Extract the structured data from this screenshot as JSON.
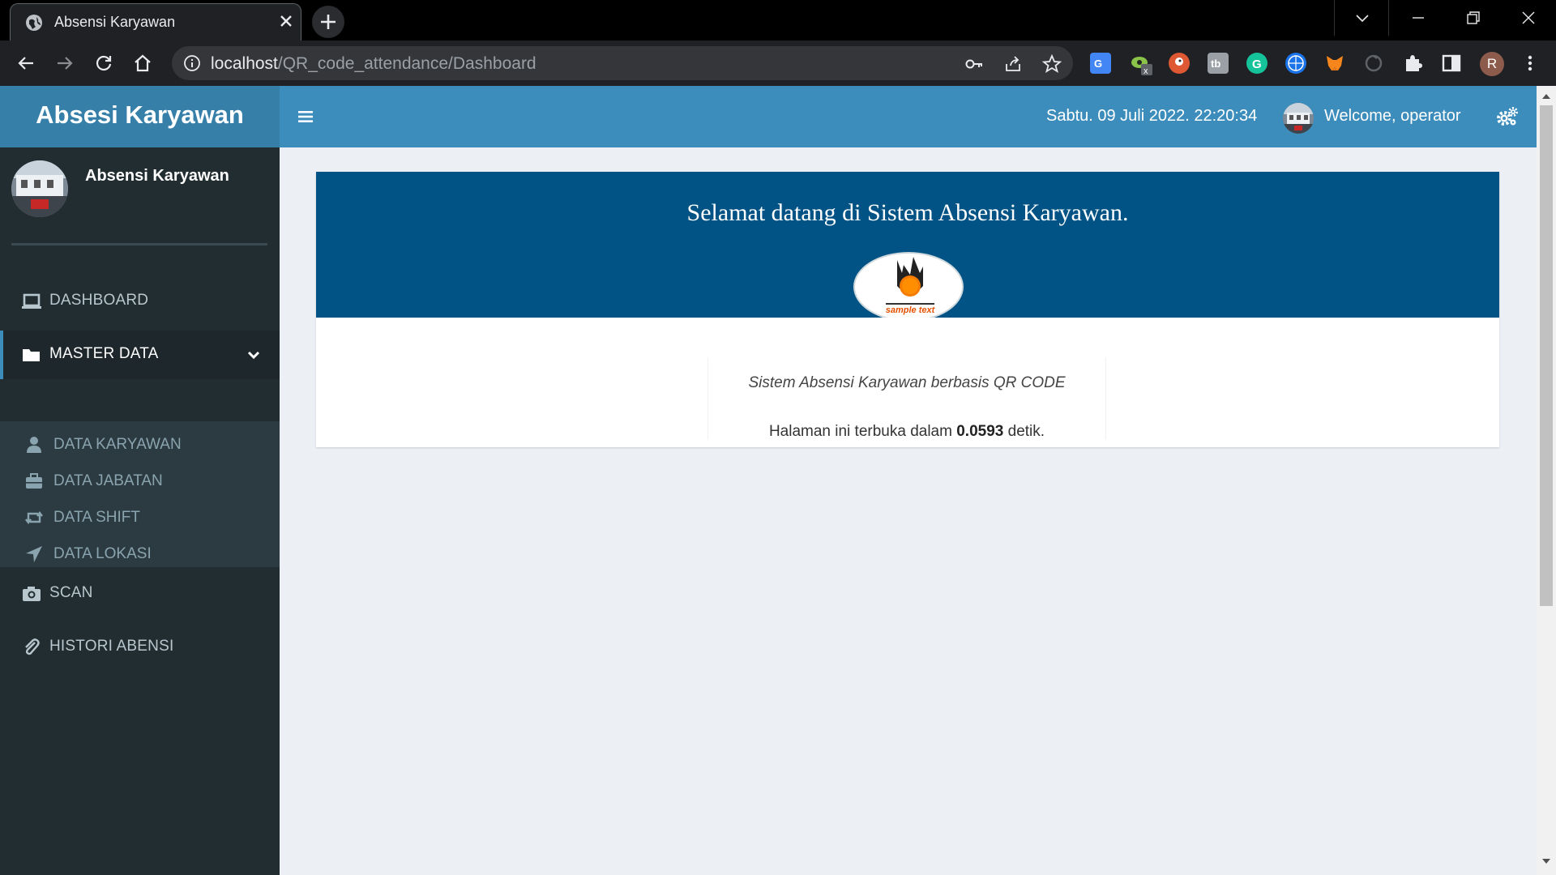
{
  "browser": {
    "tab_title": "Absensi Karyawan",
    "url_host": "localhost",
    "url_path": "/QR_code_attendance/Dashboard",
    "profile_initial": "R",
    "extensions": [
      "google-translate",
      "eye-extension",
      "duckduckgo",
      "tab-extension",
      "grammarly",
      "globe-extension",
      "metamask",
      "sync-extension",
      "puzzle-extensions",
      "sidepanel"
    ]
  },
  "header": {
    "brand": "Absesi Karyawan",
    "datetime": "Sabtu. 09 Juli 2022. 22:20:34",
    "welcome": "Welcome, operator"
  },
  "sidebar": {
    "user_name": "Absensi Karyawan",
    "menu": [
      {
        "label": "DASHBOARD",
        "icon": "laptop-icon"
      },
      {
        "label": "MASTER DATA",
        "icon": "folder-icon",
        "active": true
      },
      {
        "label": "SCAN",
        "icon": "camera-icon"
      },
      {
        "label": "HISTORI ABENSI",
        "icon": "paperclip-icon"
      }
    ],
    "submenu": [
      {
        "label": "DATA KARYAWAN",
        "icon": "user-icon"
      },
      {
        "label": "DATA JABATAN",
        "icon": "briefcase-icon"
      },
      {
        "label": "DATA SHIFT",
        "icon": "retweet-icon"
      },
      {
        "label": "DATA LOKASI",
        "icon": "location-arrow-icon"
      }
    ]
  },
  "main": {
    "welcome_title": "Selamat datang di Sistem Absensi Karyawan.",
    "logo_text": "sample text",
    "tagline": "Sistem Absensi Karyawan berbasis QR CODE",
    "load_prefix": "Halaman ini terbuka dalam ",
    "load_value": "0.0593",
    "load_suffix": " detik."
  },
  "colors": {
    "header_logo_bg": "#367fa9",
    "header_nav_bg": "#3c8dbc",
    "sidebar_bg": "#222d32",
    "jumbotron_bg": "#005384",
    "content_bg": "#ecf0f5"
  }
}
